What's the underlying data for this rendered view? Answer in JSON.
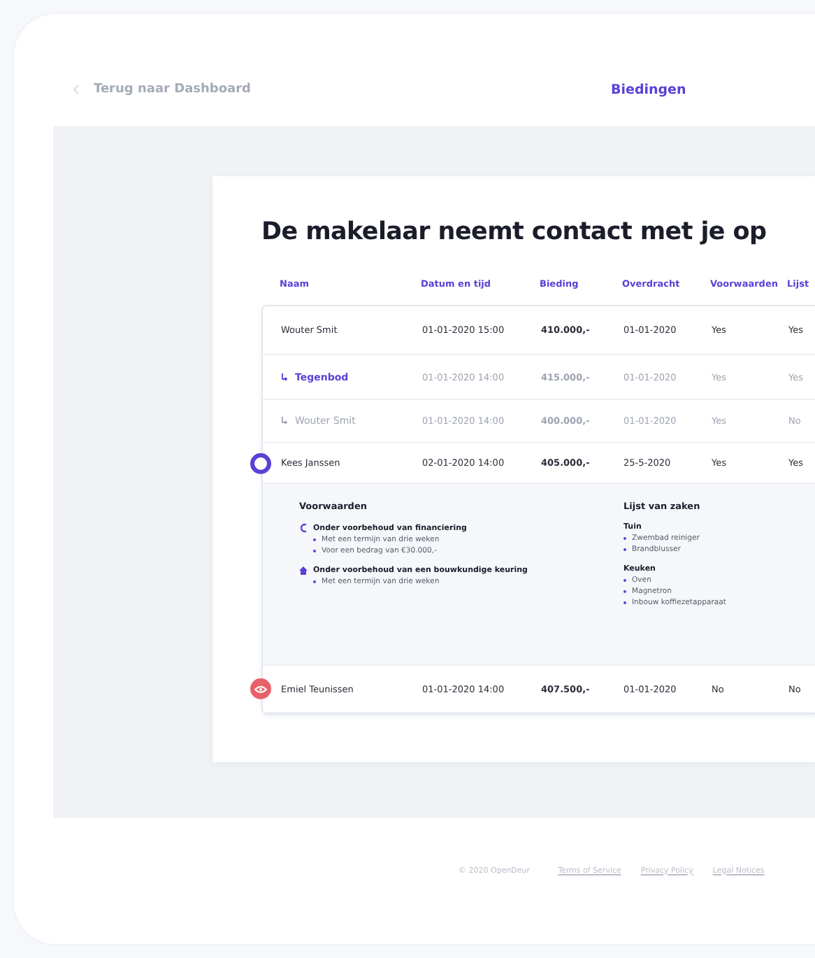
{
  "header": {
    "back_link": "Terug naar Dashboard",
    "title": "Biedingen"
  },
  "card": {
    "title": "De makelaar neemt contact met je op"
  },
  "table": {
    "columns": [
      "Naam",
      "Datum en tijd",
      "Bieding",
      "Overdracht",
      "Voorwaarden",
      "Lijst"
    ],
    "rows": [
      {
        "kind": "offer",
        "highlighted": false,
        "watched": false,
        "cells": [
          "Wouter Smit",
          "01-01-2020  15:00",
          "410.000,-",
          "01-01-2020",
          "Yes",
          "Yes"
        ]
      },
      {
        "kind": "counter",
        "highlighted": false,
        "watched": false,
        "cells": [
          "Tegenbod",
          "01-01-2020  14:00",
          "415.000,-",
          "01-01-2020",
          "Yes",
          "Yes"
        ]
      },
      {
        "kind": "history",
        "highlighted": false,
        "watched": false,
        "cells": [
          "Wouter Smit",
          "01-01-2020  14:00",
          "400.000,-",
          "01-01-2020",
          "Yes",
          "No"
        ]
      },
      {
        "kind": "offer",
        "highlighted": true,
        "watched": false,
        "cells": [
          "Kees Janssen",
          "02-01-2020  14:00",
          "405.000,-",
          "25-5-2020",
          "Yes",
          "Yes"
        ],
        "details": {
          "conditions_title": "Voorwaarden",
          "conditions": [
            {
              "kind": "financing",
              "title": "Onder voorbehoud van financiering",
              "items": [
                "Met een termijn van drie weken",
                "Voor een bedrag van €30.000,-"
              ]
            },
            {
              "kind": "inspection",
              "title": "Onder voorbehoud van een bouwkundige keuring",
              "items": [
                "Met een termijn van drie weken"
              ]
            }
          ],
          "items_title": "Lijst van zaken",
          "groups": [
            {
              "title": "Tuin",
              "items": [
                "Zwembad reiniger",
                "Brandblusser"
              ]
            },
            {
              "title": "Keuken",
              "items": [
                "Oven",
                "Magnetron",
                "Inbouw koffiezetapparaat"
              ]
            }
          ]
        }
      },
      {
        "kind": "offer",
        "highlighted": false,
        "watched": true,
        "cells": [
          "Emiel Teunissen",
          "01-01-2020  14:00",
          "407.500,-",
          "01-01-2020",
          "No",
          "No"
        ]
      }
    ]
  },
  "footer": {
    "copyright": "© 2020 OpenDeur",
    "links": [
      "Terms of Service",
      "Privacy Policy",
      "Legal Notices"
    ]
  }
}
